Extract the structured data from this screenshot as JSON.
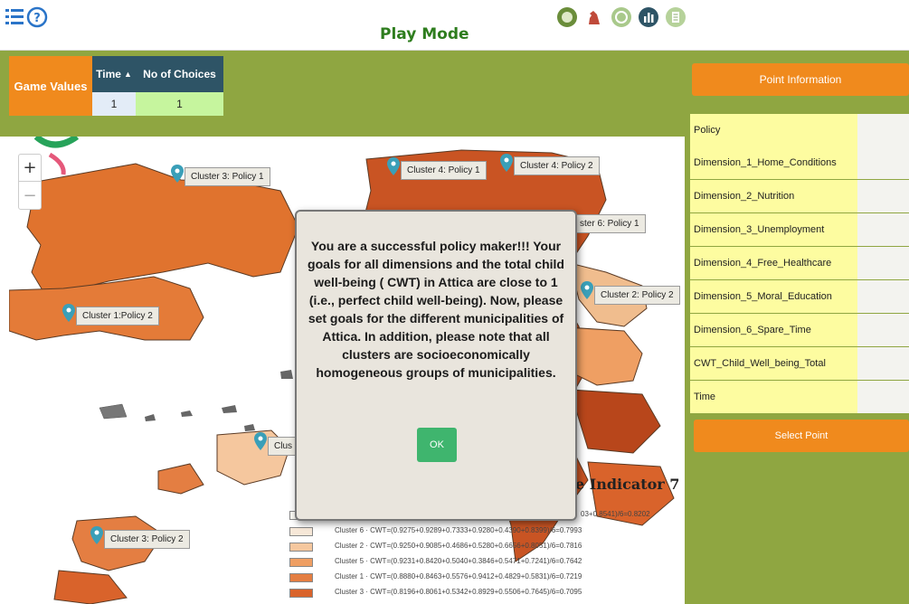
{
  "header": {
    "title": "Play Mode"
  },
  "game_values": {
    "label": "Game Values",
    "columns": [
      "Time",
      "No of Choices"
    ],
    "values": [
      "1",
      "1"
    ]
  },
  "map": {
    "zoom_in": "+",
    "zoom_out": "−",
    "cluster_labels": [
      "Cluster 3: Policy 1",
      "Cluster 4: Policy 1",
      "Cluster 4: Policy 2",
      "ster 6: Policy 1",
      "Cluster 2: Policy 2",
      "Cluster 1:Policy 2",
      "Clus",
      "Cluster 3: Policy 2"
    ]
  },
  "modal": {
    "message": "You are a successful policy maker!!! Your goals for all dimensions and the total child well-being ( CWT) in Attica are close to 1 (i.e., perfect child well-being). Now, please set goals for the different municipalities of Attica. In addition, please note that all clusters are socioeconomically homogeneous groups of municipalities.",
    "ok_label": "OK"
  },
  "legend": {
    "title": "e Indicator 7",
    "rows": [
      {
        "text": "03+0.8541)/6=0.8202",
        "color": "#fbfaf4"
      },
      {
        "text": "Cluster 6 · CWT=(0.9275+0.9289+0.7333+0.9280+0.4390+0.8399)/6=0.7993",
        "color": "#f7e8d8"
      },
      {
        "text": "Cluster 2 · CWT=(0.9250+0.9085+0.4686+0.5280+0.6656+0.8051)/6=0.7816",
        "color": "#f5c79e"
      },
      {
        "text": "Cluster 5 · CWT=(0.9231+0.8420+0.5040+0.3846+0.5471+0.7241)/6=0.7642",
        "color": "#ef9f63"
      },
      {
        "text": "Cluster 1 · CWT=(0.8880+0.8463+0.5576+0.9412+0.4829+0.5831)/6=0.7219",
        "color": "#e47e42"
      },
      {
        "text": "Cluster 3 · CWT=(0.8196+0.8061+0.5342+0.8929+0.5506+0.7645)/6=0.7095",
        "color": "#d9632b"
      }
    ]
  },
  "point_info": {
    "header": "Point Information",
    "fields": [
      "Policy",
      "Dimension_1_Home_Conditions",
      "Dimension_2_Nutrition",
      "Dimension_3_Unemployment",
      "Dimension_4_Free_Healthcare",
      "Dimension_5_Moral_Education",
      "Dimension_6_Spare_Time",
      "CWT_Child_Well_being_Total",
      "Time"
    ],
    "select_label": "Select Point"
  },
  "icons": [
    "menu-list-icon",
    "help-icon",
    "record-icon",
    "chess-knight-icon",
    "refresh-icon",
    "chart-icon",
    "document-icon"
  ]
}
